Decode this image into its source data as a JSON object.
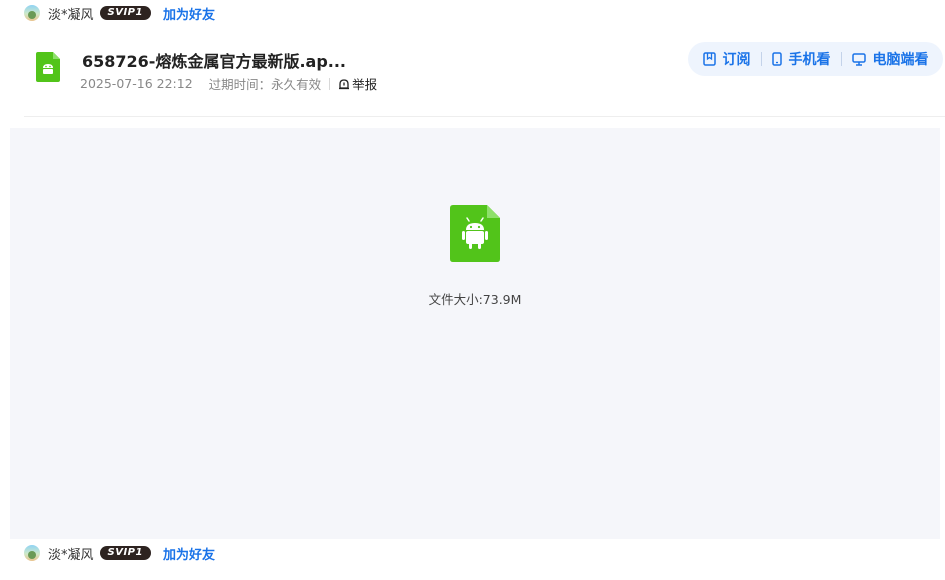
{
  "user": {
    "name": "淡*凝风",
    "vip": "SVIP1",
    "add_friend": "加为好友"
  },
  "file": {
    "name": "658726-熔炼金属官方最新版.ap...",
    "date": "2025-07-16 22:12",
    "expire": "过期时间：永久有效",
    "report": "举报",
    "size_text": "文件大小:73.9M"
  },
  "actions": {
    "subscribe": "订阅",
    "mobile": "手机看",
    "desktop": "电脑端看"
  },
  "colors": {
    "accent": "#1a73e8",
    "apk_green": "#52c41a",
    "preview_bg": "#f5f6fa",
    "vip_badge": "#2d2320"
  },
  "icons": {
    "file": "android-apk-icon",
    "subscribe": "bookmark-icon",
    "mobile": "phone-icon",
    "desktop": "monitor-icon",
    "report": "alert-icon"
  }
}
